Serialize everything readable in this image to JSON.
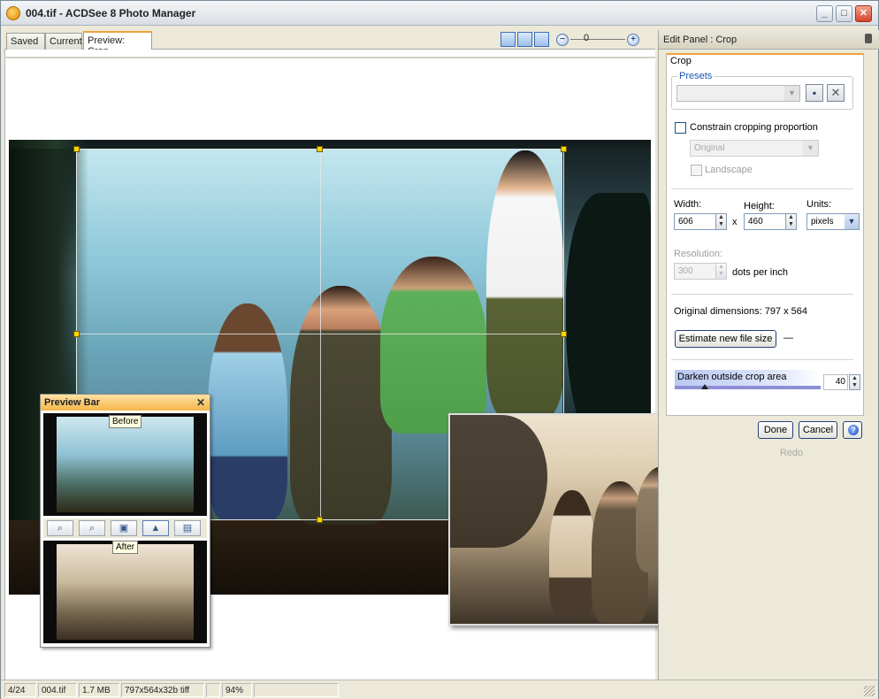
{
  "window": {
    "title": "004.tif - ACDSee 8 Photo Manager",
    "min_label": "_",
    "max_label": "□",
    "close_label": "✕"
  },
  "viewer": {
    "tabs": [
      "Saved",
      "Current",
      "Preview: Crop"
    ],
    "zoom_value": "0",
    "zoom_minus": "−",
    "zoom_plus": "+"
  },
  "preview_bar": {
    "title": "Preview Bar",
    "close": "✕",
    "before_label": "Before",
    "after_label": "After",
    "tools": [
      "⌕",
      "⌕",
      "▣",
      "▲",
      "▤"
    ]
  },
  "edit_panel": {
    "header": "Edit Panel : Crop",
    "section": "Crop",
    "presets_label": "Presets",
    "presets_value": "",
    "save_icon": "▪",
    "delete_icon": "✕",
    "constrain_label": "Constrain cropping proportion",
    "constrain_checked": false,
    "ratio_value": "Original",
    "landscape_label": "Landscape",
    "width_label": "Width:",
    "width_value": "606",
    "height_label": "Height:",
    "height_value": "460",
    "times": "x",
    "units_label": "Units:",
    "units_value": "pixels",
    "resolution_label": "Resolution:",
    "resolution_value": "300",
    "dpi_label": "dots per inch",
    "original_dimensions": "Original dimensions: 797 x 564",
    "estimate_button": "Estimate new file size",
    "estimate_result": "—",
    "darken_label": "Darken outside crop area",
    "darken_value": "40",
    "done_button": "Done",
    "cancel_button": "Cancel",
    "redo_button": "Redo",
    "help_icon": "?"
  },
  "statusbar": {
    "index": "4/24",
    "filename": "004.tif",
    "filesize": "1.7 MB",
    "dimensions": "797x564x32b tiff",
    "zoom": "94%"
  },
  "colors": {
    "accent_orange": "#f0a33a",
    "window_bg": "#ece9d8",
    "button_border": "#24407a"
  }
}
